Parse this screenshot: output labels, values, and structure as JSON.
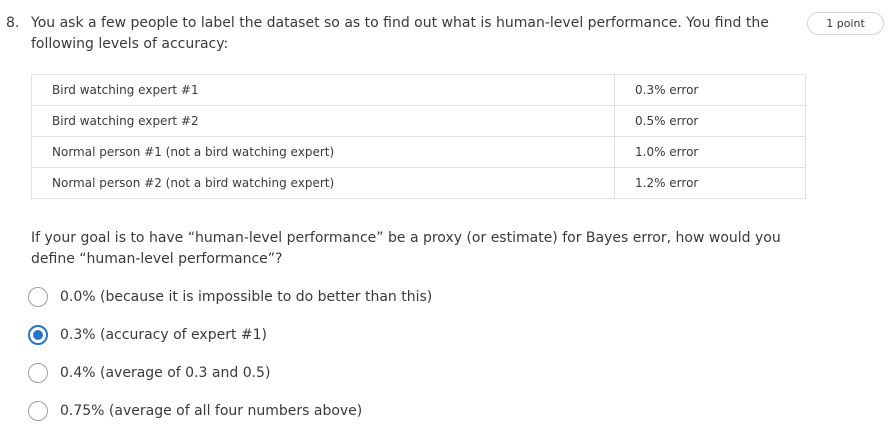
{
  "question": {
    "number": "8.",
    "prompt": "You ask a few people to label the dataset so as to find out what is human-level performance. You find the following levels of accuracy:",
    "points": "1 point",
    "table": [
      {
        "person": "Bird watching expert #1",
        "error": "0.3% error"
      },
      {
        "person": "Bird watching expert #2",
        "error": "0.5% error"
      },
      {
        "person": "Normal person #1 (not a bird watching expert)",
        "error": "1.0% error"
      },
      {
        "person": "Normal person #2 (not a bird watching expert)",
        "error": "1.2% error"
      }
    ],
    "sub_prompt": "If your goal is to have “human-level performance” be a proxy (or estimate) for Bayes error, how would you define “human-level performance”?",
    "options": [
      {
        "label": "0.0% (because it is impossible to do better than this)",
        "selected": false
      },
      {
        "label": "0.3% (accuracy of expert #1)",
        "selected": true
      },
      {
        "label": "0.4% (average of 0.3 and 0.5)",
        "selected": false
      },
      {
        "label": "0.75% (average of all four numbers above)",
        "selected": false
      }
    ]
  },
  "colors": {
    "text": "#373a3c",
    "accent": "#2a73cc",
    "border": "#e0e0e0"
  }
}
